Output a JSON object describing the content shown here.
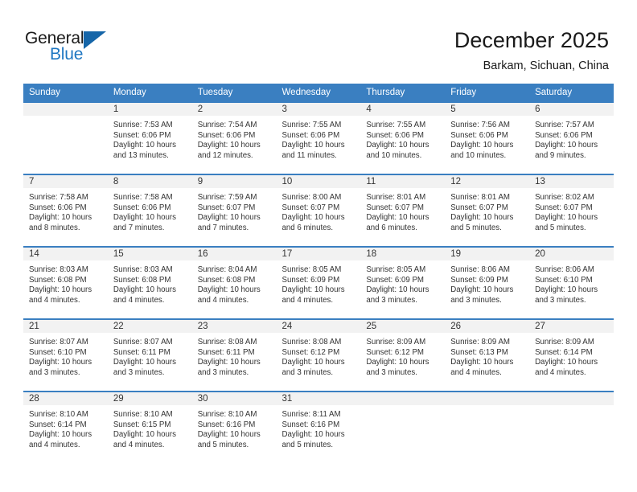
{
  "brand": {
    "name_part1": "General",
    "name_part2": "Blue",
    "triangle_icon": "triangle-icon",
    "color_dark": "#1a1a1a",
    "color_blue": "#1f77c2"
  },
  "header": {
    "title": "December 2025",
    "location": "Barkam, Sichuan, China"
  },
  "calendar": {
    "accent_color": "#3a7fc1",
    "daynum_band_color": "#f2f2f2",
    "weekday_headers": [
      "Sunday",
      "Monday",
      "Tuesday",
      "Wednesday",
      "Thursday",
      "Friday",
      "Saturday"
    ],
    "weeks": [
      [
        {
          "day": "",
          "sunrise": "",
          "sunset": "",
          "daylight_line1": "",
          "daylight_line2": ""
        },
        {
          "day": "1",
          "sunrise": "Sunrise: 7:53 AM",
          "sunset": "Sunset: 6:06 PM",
          "daylight_line1": "Daylight: 10 hours",
          "daylight_line2": "and 13 minutes."
        },
        {
          "day": "2",
          "sunrise": "Sunrise: 7:54 AM",
          "sunset": "Sunset: 6:06 PM",
          "daylight_line1": "Daylight: 10 hours",
          "daylight_line2": "and 12 minutes."
        },
        {
          "day": "3",
          "sunrise": "Sunrise: 7:55 AM",
          "sunset": "Sunset: 6:06 PM",
          "daylight_line1": "Daylight: 10 hours",
          "daylight_line2": "and 11 minutes."
        },
        {
          "day": "4",
          "sunrise": "Sunrise: 7:55 AM",
          "sunset": "Sunset: 6:06 PM",
          "daylight_line1": "Daylight: 10 hours",
          "daylight_line2": "and 10 minutes."
        },
        {
          "day": "5",
          "sunrise": "Sunrise: 7:56 AM",
          "sunset": "Sunset: 6:06 PM",
          "daylight_line1": "Daylight: 10 hours",
          "daylight_line2": "and 10 minutes."
        },
        {
          "day": "6",
          "sunrise": "Sunrise: 7:57 AM",
          "sunset": "Sunset: 6:06 PM",
          "daylight_line1": "Daylight: 10 hours",
          "daylight_line2": "and 9 minutes."
        }
      ],
      [
        {
          "day": "7",
          "sunrise": "Sunrise: 7:58 AM",
          "sunset": "Sunset: 6:06 PM",
          "daylight_line1": "Daylight: 10 hours",
          "daylight_line2": "and 8 minutes."
        },
        {
          "day": "8",
          "sunrise": "Sunrise: 7:58 AM",
          "sunset": "Sunset: 6:06 PM",
          "daylight_line1": "Daylight: 10 hours",
          "daylight_line2": "and 7 minutes."
        },
        {
          "day": "9",
          "sunrise": "Sunrise: 7:59 AM",
          "sunset": "Sunset: 6:07 PM",
          "daylight_line1": "Daylight: 10 hours",
          "daylight_line2": "and 7 minutes."
        },
        {
          "day": "10",
          "sunrise": "Sunrise: 8:00 AM",
          "sunset": "Sunset: 6:07 PM",
          "daylight_line1": "Daylight: 10 hours",
          "daylight_line2": "and 6 minutes."
        },
        {
          "day": "11",
          "sunrise": "Sunrise: 8:01 AM",
          "sunset": "Sunset: 6:07 PM",
          "daylight_line1": "Daylight: 10 hours",
          "daylight_line2": "and 6 minutes."
        },
        {
          "day": "12",
          "sunrise": "Sunrise: 8:01 AM",
          "sunset": "Sunset: 6:07 PM",
          "daylight_line1": "Daylight: 10 hours",
          "daylight_line2": "and 5 minutes."
        },
        {
          "day": "13",
          "sunrise": "Sunrise: 8:02 AM",
          "sunset": "Sunset: 6:07 PM",
          "daylight_line1": "Daylight: 10 hours",
          "daylight_line2": "and 5 minutes."
        }
      ],
      [
        {
          "day": "14",
          "sunrise": "Sunrise: 8:03 AM",
          "sunset": "Sunset: 6:08 PM",
          "daylight_line1": "Daylight: 10 hours",
          "daylight_line2": "and 4 minutes."
        },
        {
          "day": "15",
          "sunrise": "Sunrise: 8:03 AM",
          "sunset": "Sunset: 6:08 PM",
          "daylight_line1": "Daylight: 10 hours",
          "daylight_line2": "and 4 minutes."
        },
        {
          "day": "16",
          "sunrise": "Sunrise: 8:04 AM",
          "sunset": "Sunset: 6:08 PM",
          "daylight_line1": "Daylight: 10 hours",
          "daylight_line2": "and 4 minutes."
        },
        {
          "day": "17",
          "sunrise": "Sunrise: 8:05 AM",
          "sunset": "Sunset: 6:09 PM",
          "daylight_line1": "Daylight: 10 hours",
          "daylight_line2": "and 4 minutes."
        },
        {
          "day": "18",
          "sunrise": "Sunrise: 8:05 AM",
          "sunset": "Sunset: 6:09 PM",
          "daylight_line1": "Daylight: 10 hours",
          "daylight_line2": "and 3 minutes."
        },
        {
          "day": "19",
          "sunrise": "Sunrise: 8:06 AM",
          "sunset": "Sunset: 6:09 PM",
          "daylight_line1": "Daylight: 10 hours",
          "daylight_line2": "and 3 minutes."
        },
        {
          "day": "20",
          "sunrise": "Sunrise: 8:06 AM",
          "sunset": "Sunset: 6:10 PM",
          "daylight_line1": "Daylight: 10 hours",
          "daylight_line2": "and 3 minutes."
        }
      ],
      [
        {
          "day": "21",
          "sunrise": "Sunrise: 8:07 AM",
          "sunset": "Sunset: 6:10 PM",
          "daylight_line1": "Daylight: 10 hours",
          "daylight_line2": "and 3 minutes."
        },
        {
          "day": "22",
          "sunrise": "Sunrise: 8:07 AM",
          "sunset": "Sunset: 6:11 PM",
          "daylight_line1": "Daylight: 10 hours",
          "daylight_line2": "and 3 minutes."
        },
        {
          "day": "23",
          "sunrise": "Sunrise: 8:08 AM",
          "sunset": "Sunset: 6:11 PM",
          "daylight_line1": "Daylight: 10 hours",
          "daylight_line2": "and 3 minutes."
        },
        {
          "day": "24",
          "sunrise": "Sunrise: 8:08 AM",
          "sunset": "Sunset: 6:12 PM",
          "daylight_line1": "Daylight: 10 hours",
          "daylight_line2": "and 3 minutes."
        },
        {
          "day": "25",
          "sunrise": "Sunrise: 8:09 AM",
          "sunset": "Sunset: 6:12 PM",
          "daylight_line1": "Daylight: 10 hours",
          "daylight_line2": "and 3 minutes."
        },
        {
          "day": "26",
          "sunrise": "Sunrise: 8:09 AM",
          "sunset": "Sunset: 6:13 PM",
          "daylight_line1": "Daylight: 10 hours",
          "daylight_line2": "and 4 minutes."
        },
        {
          "day": "27",
          "sunrise": "Sunrise: 8:09 AM",
          "sunset": "Sunset: 6:14 PM",
          "daylight_line1": "Daylight: 10 hours",
          "daylight_line2": "and 4 minutes."
        }
      ],
      [
        {
          "day": "28",
          "sunrise": "Sunrise: 8:10 AM",
          "sunset": "Sunset: 6:14 PM",
          "daylight_line1": "Daylight: 10 hours",
          "daylight_line2": "and 4 minutes."
        },
        {
          "day": "29",
          "sunrise": "Sunrise: 8:10 AM",
          "sunset": "Sunset: 6:15 PM",
          "daylight_line1": "Daylight: 10 hours",
          "daylight_line2": "and 4 minutes."
        },
        {
          "day": "30",
          "sunrise": "Sunrise: 8:10 AM",
          "sunset": "Sunset: 6:16 PM",
          "daylight_line1": "Daylight: 10 hours",
          "daylight_line2": "and 5 minutes."
        },
        {
          "day": "31",
          "sunrise": "Sunrise: 8:11 AM",
          "sunset": "Sunset: 6:16 PM",
          "daylight_line1": "Daylight: 10 hours",
          "daylight_line2": "and 5 minutes."
        },
        {
          "day": "",
          "sunrise": "",
          "sunset": "",
          "daylight_line1": "",
          "daylight_line2": ""
        },
        {
          "day": "",
          "sunrise": "",
          "sunset": "",
          "daylight_line1": "",
          "daylight_line2": ""
        },
        {
          "day": "",
          "sunrise": "",
          "sunset": "",
          "daylight_line1": "",
          "daylight_line2": ""
        }
      ]
    ]
  }
}
